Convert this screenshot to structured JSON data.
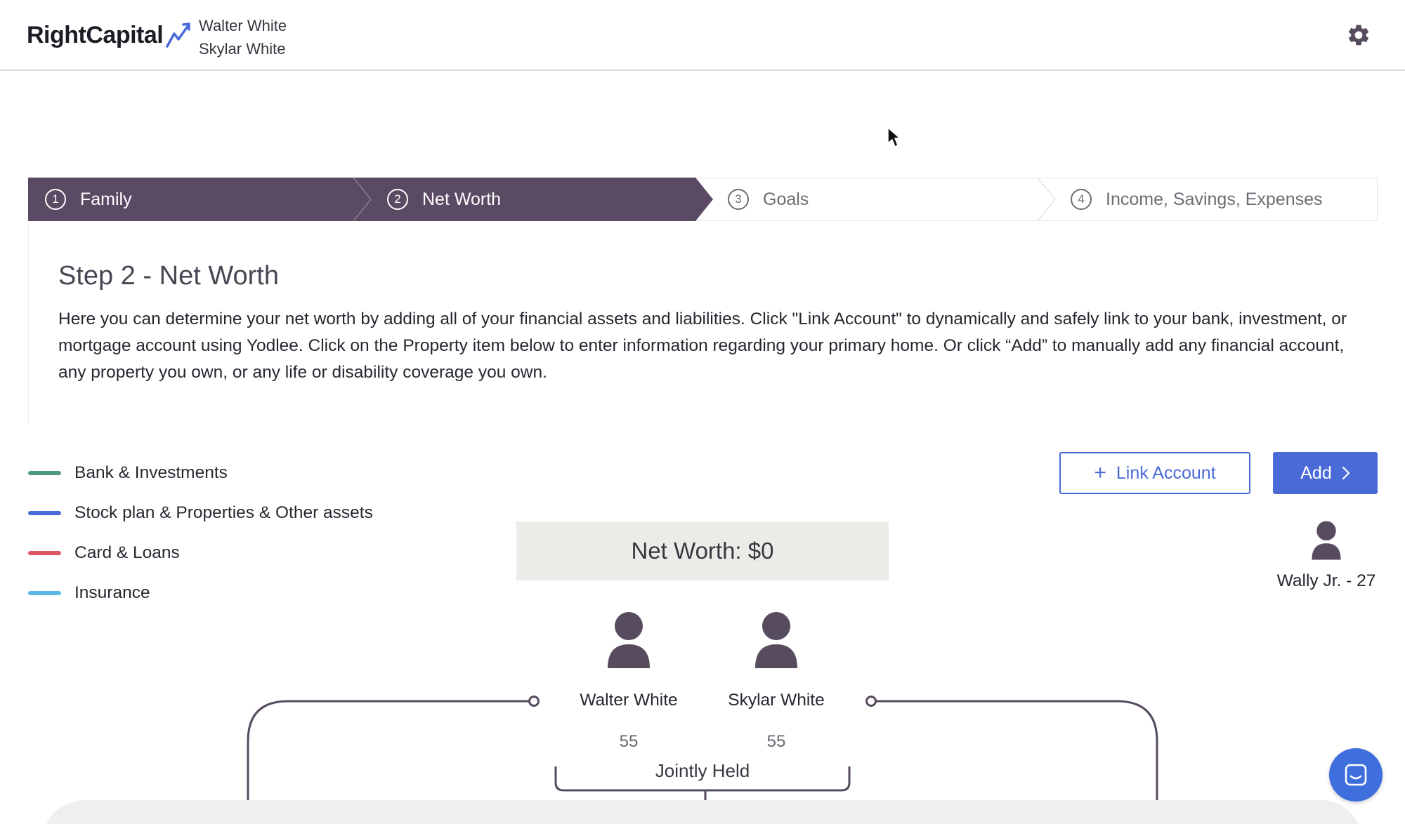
{
  "header": {
    "brand": "RightCapital",
    "clients": [
      "Walter White",
      "Skylar White"
    ],
    "settings_icon": "gear-icon"
  },
  "stepper": {
    "steps": [
      {
        "number": "1",
        "label": "Family",
        "state": "completed"
      },
      {
        "number": "2",
        "label": "Net Worth",
        "state": "active"
      },
      {
        "number": "3",
        "label": "Goals",
        "state": "upcoming"
      },
      {
        "number": "4",
        "label": "Income, Savings, Expenses",
        "state": "upcoming"
      }
    ]
  },
  "step": {
    "title": "Step 2 - Net Worth",
    "description": "Here you can determine your net worth by adding all of your financial assets and liabilities. Click \"Link Account\" to dynamically and safely link to your bank, investment, or mortgage account using Yodlee. Click on the Property item below to enter information regarding your primary home. Or click “Add” to manually add any financial account, any property you own, or any life or disability coverage you own."
  },
  "legend": [
    {
      "label": "Bank & Investments",
      "color": "#4e9a7e"
    },
    {
      "label": "Stock plan & Properties & Other assets",
      "color": "#4a6ad8"
    },
    {
      "label": "Card & Loans",
      "color": "#e05563"
    },
    {
      "label": "Insurance",
      "color": "#5bb8e6"
    }
  ],
  "actions": {
    "link_account": "Link Account",
    "add": "Add"
  },
  "net_worth": {
    "label": "Net Worth: $0"
  },
  "people": {
    "walter": {
      "name": "Walter White",
      "age": "55"
    },
    "skylar": {
      "name": "Skylar White",
      "age": "55"
    },
    "child": {
      "name": "Wally Jr. - 27"
    }
  },
  "jointly_held": "Jointly Held",
  "colors": {
    "stepper_active": "#5b4a64",
    "primary": "#4a6ad8",
    "avatar": "#574b5e"
  }
}
